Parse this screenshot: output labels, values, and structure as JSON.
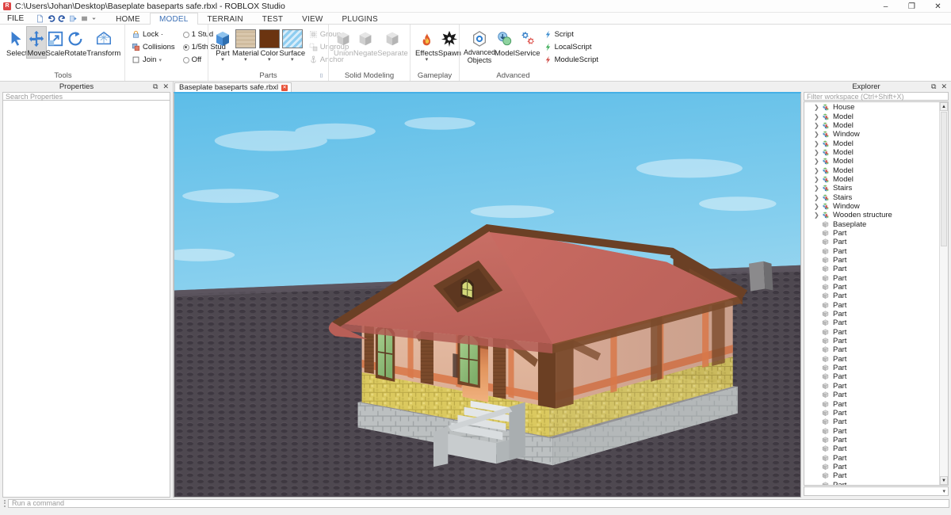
{
  "window": {
    "title": "C:\\Users\\Johan\\Desktop\\Baseplate baseparts safe.rbxl - ROBLOX Studio",
    "app_icon": "roblox-icon",
    "minimize": "–",
    "maximize": "❐",
    "close": "✕"
  },
  "menu": {
    "file_label": "FILE",
    "quick_access": [
      {
        "name": "new-file-icon"
      },
      {
        "name": "undo-icon"
      },
      {
        "name": "redo-icon"
      },
      {
        "name": "play-icon"
      },
      {
        "name": "stop-icon"
      },
      {
        "name": "qat-overflow-icon"
      }
    ],
    "tabs": [
      {
        "label": "HOME",
        "active": false
      },
      {
        "label": "MODEL",
        "active": true
      },
      {
        "label": "TERRAIN",
        "active": false
      },
      {
        "label": "TEST",
        "active": false
      },
      {
        "label": "VIEW",
        "active": false
      },
      {
        "label": "PLUGINS",
        "active": false
      }
    ]
  },
  "ribbon": {
    "groups": [
      {
        "name": "tools",
        "title": "Tools",
        "buttons": [
          {
            "label": "Select",
            "icon": "cursor-arrow-icon",
            "selected": false
          },
          {
            "label": "Move",
            "icon": "move-arrows-icon",
            "selected": true
          },
          {
            "label": "Scale",
            "icon": "scale-icon",
            "selected": false
          },
          {
            "label": "Rotate",
            "icon": "rotate-icon",
            "selected": false
          },
          {
            "label": "Transform",
            "icon": "transform-icon",
            "selected": false
          }
        ]
      },
      {
        "name": "snap",
        "title": "",
        "left_items": [
          {
            "label": "Lock ·",
            "icon": "lock-icon"
          },
          {
            "label": "Collisions",
            "icon": "collisions-icon"
          },
          {
            "label": "Join",
            "icon": "join-icon",
            "caret": "▾"
          }
        ],
        "right_items": [
          {
            "label": "1 Stud",
            "selected": false
          },
          {
            "label": "1/5th Stud",
            "selected": true
          },
          {
            "label": "Off",
            "selected": false
          }
        ]
      },
      {
        "name": "parts",
        "title": "Parts",
        "dialog_launcher": "⌷",
        "buttons": [
          {
            "label": "Part",
            "icon": "part-cube-icon",
            "caret": "▾",
            "color": "#4a90d9"
          },
          {
            "label": "Material",
            "icon": "material-brick-icon",
            "caret": "▾",
            "color": "#d6c3a5"
          },
          {
            "label": "Color",
            "icon": "color-swatch-icon",
            "caret": "▾",
            "color": "#6b3410"
          },
          {
            "label": "Surface",
            "icon": "surface-icon",
            "caret": "▾",
            "color": "#6fb7e8"
          }
        ],
        "small_items": [
          {
            "label": "Group",
            "icon": "group-icon",
            "disabled": true
          },
          {
            "label": "Ungroup",
            "icon": "ungroup-icon",
            "disabled": true
          },
          {
            "label": "Anchor",
            "icon": "anchor-icon",
            "disabled": true
          }
        ]
      },
      {
        "name": "solid-modeling",
        "title": "Solid Modeling",
        "dialog_launcher": "⌷",
        "buttons": [
          {
            "label": "Union",
            "icon": "union-icon",
            "disabled": true
          },
          {
            "label": "Negate",
            "icon": "negate-icon",
            "disabled": true
          },
          {
            "label": "Separate",
            "icon": "separate-icon",
            "disabled": true
          }
        ]
      },
      {
        "name": "gameplay",
        "title": "Gameplay",
        "buttons": [
          {
            "label": "Effects",
            "icon": "flame-icon",
            "caret": "▾"
          },
          {
            "label": "Spawn",
            "icon": "spawn-star-icon"
          }
        ]
      },
      {
        "name": "advanced",
        "title": "Advanced",
        "buttons": [
          {
            "label": "Advanced\nObjects",
            "icon": "advanced-objects-icon"
          },
          {
            "label": "Model",
            "icon": "model-insert-icon"
          },
          {
            "label": "Service",
            "icon": "service-gears-icon"
          }
        ],
        "small_items": [
          {
            "label": "Script",
            "icon": "script-icon",
            "color": "#3f8fd0"
          },
          {
            "label": "LocalScript",
            "icon": "localscript-icon",
            "color": "#3fae5a"
          },
          {
            "label": "ModuleScript",
            "icon": "modulescript-icon",
            "color": "#d0504a"
          }
        ]
      }
    ]
  },
  "properties": {
    "title": "Properties",
    "float_icon": "⧉",
    "close_icon": "✕",
    "search_placeholder": "Search Properties"
  },
  "document_tabs": [
    {
      "label": "Baseplate baseparts safe.rbxl",
      "close": "✕",
      "active": true
    }
  ],
  "explorer": {
    "title": "Explorer",
    "float_icon": "⧉",
    "close_icon": "✕",
    "filter_placeholder": "Filter workspace (Ctrl+Shift+X)",
    "scroll_up": "▲",
    "scroll_down": "▼",
    "bottom_caret": "▾",
    "items": [
      {
        "label": "House",
        "icon": "model-icon",
        "expandable": true
      },
      {
        "label": "Model",
        "icon": "model-icon",
        "expandable": true
      },
      {
        "label": "Model",
        "icon": "model-icon",
        "expandable": true
      },
      {
        "label": "Window",
        "icon": "model-icon",
        "expandable": true
      },
      {
        "label": "Model",
        "icon": "model-icon",
        "expandable": true
      },
      {
        "label": "Model",
        "icon": "model-icon",
        "expandable": true
      },
      {
        "label": "Model",
        "icon": "model-icon",
        "expandable": true
      },
      {
        "label": "Model",
        "icon": "model-icon",
        "expandable": true
      },
      {
        "label": "Model",
        "icon": "model-icon",
        "expandable": true
      },
      {
        "label": "Stairs",
        "icon": "model-icon",
        "expandable": true
      },
      {
        "label": "Stairs",
        "icon": "model-icon",
        "expandable": true
      },
      {
        "label": "Window",
        "icon": "model-icon",
        "expandable": true
      },
      {
        "label": "Wooden structure",
        "icon": "model-icon",
        "expandable": true
      },
      {
        "label": "Baseplate",
        "icon": "part-icon",
        "expandable": false
      },
      {
        "label": "Part",
        "icon": "part-icon",
        "expandable": false
      },
      {
        "label": "Part",
        "icon": "part-icon",
        "expandable": false
      },
      {
        "label": "Part",
        "icon": "part-icon",
        "expandable": false
      },
      {
        "label": "Part",
        "icon": "part-icon",
        "expandable": false
      },
      {
        "label": "Part",
        "icon": "part-icon",
        "expandable": false
      },
      {
        "label": "Part",
        "icon": "part-icon",
        "expandable": false
      },
      {
        "label": "Part",
        "icon": "part-icon",
        "expandable": false
      },
      {
        "label": "Part",
        "icon": "part-icon",
        "expandable": false
      },
      {
        "label": "Part",
        "icon": "part-icon",
        "expandable": false
      },
      {
        "label": "Part",
        "icon": "part-icon",
        "expandable": false
      },
      {
        "label": "Part",
        "icon": "part-icon",
        "expandable": false
      },
      {
        "label": "Part",
        "icon": "part-icon",
        "expandable": false
      },
      {
        "label": "Part",
        "icon": "part-icon",
        "expandable": false
      },
      {
        "label": "Part",
        "icon": "part-icon",
        "expandable": false
      },
      {
        "label": "Part",
        "icon": "part-icon",
        "expandable": false
      },
      {
        "label": "Part",
        "icon": "part-icon",
        "expandable": false
      },
      {
        "label": "Part",
        "icon": "part-icon",
        "expandable": false
      },
      {
        "label": "Part",
        "icon": "part-icon",
        "expandable": false
      },
      {
        "label": "Part",
        "icon": "part-icon",
        "expandable": false
      },
      {
        "label": "Part",
        "icon": "part-icon",
        "expandable": false
      },
      {
        "label": "Part",
        "icon": "part-icon",
        "expandable": false
      },
      {
        "label": "Part",
        "icon": "part-icon",
        "expandable": false
      },
      {
        "label": "Part",
        "icon": "part-icon",
        "expandable": false
      },
      {
        "label": "Part",
        "icon": "part-icon",
        "expandable": false
      },
      {
        "label": "Part",
        "icon": "part-icon",
        "expandable": false
      },
      {
        "label": "Part",
        "icon": "part-icon",
        "expandable": false
      },
      {
        "label": "Part",
        "icon": "part-icon",
        "expandable": false
      },
      {
        "label": "Part",
        "icon": "part-icon",
        "expandable": false
      },
      {
        "label": "Part",
        "icon": "part-icon",
        "expandable": false
      },
      {
        "label": "Part",
        "icon": "part-icon",
        "expandable": false
      }
    ]
  },
  "statusbar": {
    "command_placeholder": "Run a command",
    "grip_icon": "drag-grip-icon"
  },
  "viewport": {
    "scene_name": "timber-frame-house-on-baseplate",
    "sky_top": "#6cc2ea",
    "sky_bottom": "#b9dff0",
    "baseplate_color": "#4f4a4e",
    "roof_color": "#c4685f",
    "roof_shadow": "#a8544c",
    "timber_color": "#7a4a2b",
    "wall_color": "#e0b49a",
    "stone_color": "#dcc96a",
    "foundation_color": "#b9bcbd",
    "door_glow": "#e09a62"
  }
}
